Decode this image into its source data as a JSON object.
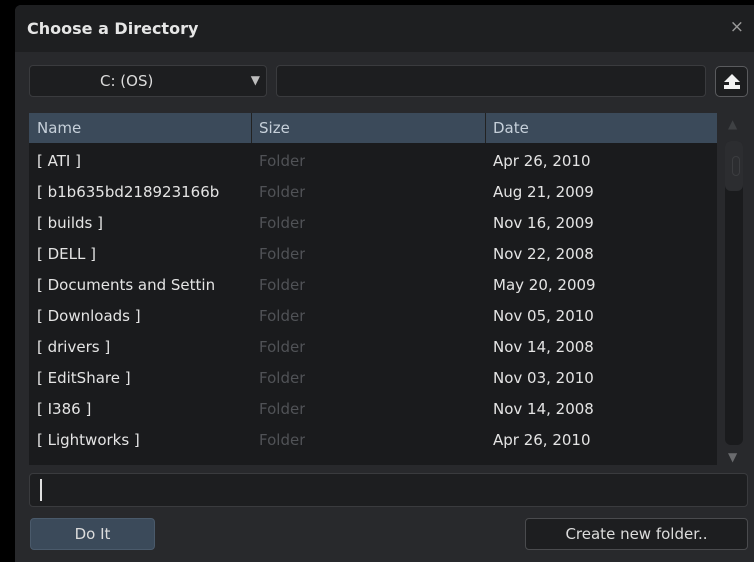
{
  "window": {
    "title": "Choose a Directory",
    "close_glyph": "×"
  },
  "drive": {
    "selected": "C: (OS)",
    "arrow": "▼"
  },
  "path": {
    "value": ""
  },
  "up_button": {
    "icon": "up-arrow-icon"
  },
  "list": {
    "columns": [
      "Name",
      "Size",
      "Date"
    ],
    "rows": [
      {
        "name": "[ ATI ]",
        "size": "Folder",
        "date": "Apr 26, 2010"
      },
      {
        "name": "[ b1b635bd218923166b",
        "size": "Folder",
        "date": "Aug 21, 2009"
      },
      {
        "name": "[ builds ]",
        "size": "Folder",
        "date": "Nov 16, 2009"
      },
      {
        "name": "[ DELL ]",
        "size": "Folder",
        "date": "Nov 22, 2008"
      },
      {
        "name": "[ Documents and Settin",
        "size": "Folder",
        "date": "May 20, 2009"
      },
      {
        "name": "[ Downloads ]",
        "size": "Folder",
        "date": "Nov 05, 2010"
      },
      {
        "name": "[ drivers ]",
        "size": "Folder",
        "date": "Nov 14, 2008"
      },
      {
        "name": "[ EditShare ]",
        "size": "Folder",
        "date": "Nov 03, 2010"
      },
      {
        "name": "[ I386 ]",
        "size": "Folder",
        "date": "Nov 14, 2008"
      },
      {
        "name": "[ Lightworks ]",
        "size": "Folder",
        "date": "Apr 26, 2010"
      }
    ]
  },
  "scrollbar": {
    "up": "▲",
    "down": "▼"
  },
  "name_field": {
    "value": ""
  },
  "buttons": {
    "do_it": "Do It",
    "new_folder": "Create new folder.."
  },
  "colors": {
    "accent": "#3b4a5a",
    "background": "#28292c",
    "muted": "#505256"
  }
}
